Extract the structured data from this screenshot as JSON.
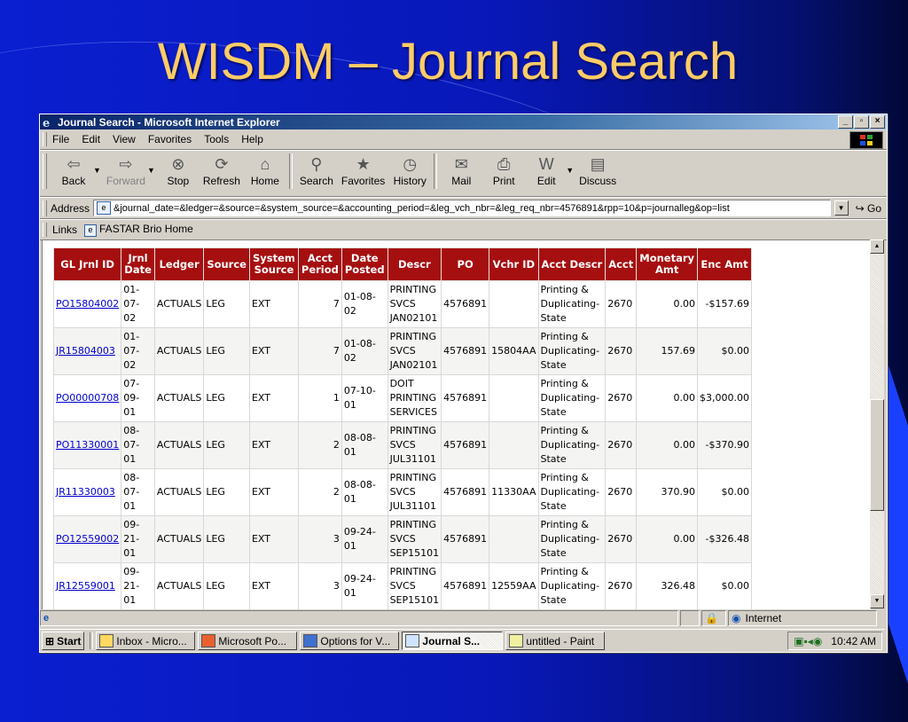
{
  "slide": {
    "title": "WISDM – Journal Search"
  },
  "window": {
    "title": "Journal Search - Microsoft Internet Explorer",
    "min": "_",
    "max": "▫",
    "close": "×"
  },
  "menu": [
    "File",
    "Edit",
    "View",
    "Favorites",
    "Tools",
    "Help"
  ],
  "toolbar": {
    "back": "Back",
    "forward": "Forward",
    "stop": "Stop",
    "refresh": "Refresh",
    "home": "Home",
    "search": "Search",
    "favorites": "Favorites",
    "history": "History",
    "mail": "Mail",
    "print": "Print",
    "edit": "Edit",
    "discuss": "Discuss"
  },
  "address": {
    "label": "Address",
    "value": "&journal_date=&ledger=&source=&system_source=&accounting_period=&leg_vch_nbr=&leg_req_nbr=4576891&rpp=10&p=journalleg&op=list",
    "go": "Go"
  },
  "links": {
    "label": "Links",
    "item": "FASTAR Brio Home"
  },
  "table": {
    "headers": [
      [
        "GL Jrnl ID"
      ],
      [
        "Jrnl",
        "Date"
      ],
      [
        "Ledger"
      ],
      [
        "Source"
      ],
      [
        "System",
        "Source"
      ],
      [
        "Acct",
        "Period"
      ],
      [
        "Date",
        "Posted"
      ],
      [
        "Descr"
      ],
      [
        "PO"
      ],
      [
        "Vchr ID"
      ],
      [
        "Acct Descr"
      ],
      [
        "Acct"
      ],
      [
        "Monetary",
        "Amt"
      ],
      [
        "Enc Amt"
      ]
    ],
    "rows": [
      {
        "id": "PO15804002",
        "jdate": [
          "01-",
          "07-",
          "02"
        ],
        "ledger": "ACTUALS",
        "source": "LEG",
        "sys": "EXT",
        "period": "7",
        "posted": [
          "01-08-",
          "02"
        ],
        "descr": [
          "PRINTING",
          "SVCS",
          "JAN02101"
        ],
        "po": "4576891",
        "vchr": "",
        "adescr": [
          "Printing &",
          "Duplicating-",
          "State"
        ],
        "acct": "2670",
        "mon": "0.00",
        "enc": "-$157.69"
      },
      {
        "id": "JR15804003",
        "jdate": [
          "01-",
          "07-",
          "02"
        ],
        "ledger": "ACTUALS",
        "source": "LEG",
        "sys": "EXT",
        "period": "7",
        "posted": [
          "01-08-",
          "02"
        ],
        "descr": [
          "PRINTING",
          "SVCS",
          "JAN02101"
        ],
        "po": "4576891",
        "vchr": "15804AA",
        "adescr": [
          "Printing &",
          "Duplicating-",
          "State"
        ],
        "acct": "2670",
        "mon": "157.69",
        "enc": "$0.00"
      },
      {
        "id": "PO00000708",
        "jdate": [
          "07-",
          "09-",
          "01"
        ],
        "ledger": "ACTUALS",
        "source": "LEG",
        "sys": "EXT",
        "period": "1",
        "posted": [
          "07-10-",
          "01"
        ],
        "descr": [
          "DOIT",
          "PRINTING",
          "SERVICES"
        ],
        "po": "4576891",
        "vchr": "",
        "adescr": [
          "Printing &",
          "Duplicating-",
          "State"
        ],
        "acct": "2670",
        "mon": "0.00",
        "enc": "$3,000.00"
      },
      {
        "id": "PO11330001",
        "jdate": [
          "08-",
          "07-",
          "01"
        ],
        "ledger": "ACTUALS",
        "source": "LEG",
        "sys": "EXT",
        "period": "2",
        "posted": [
          "08-08-",
          "01"
        ],
        "descr": [
          "PRINTING",
          "SVCS",
          "JUL31101"
        ],
        "po": "4576891",
        "vchr": "",
        "adescr": [
          "Printing &",
          "Duplicating-",
          "State"
        ],
        "acct": "2670",
        "mon": "0.00",
        "enc": "-$370.90"
      },
      {
        "id": "JR11330003",
        "jdate": [
          "08-",
          "07-",
          "01"
        ],
        "ledger": "ACTUALS",
        "source": "LEG",
        "sys": "EXT",
        "period": "2",
        "posted": [
          "08-08-",
          "01"
        ],
        "descr": [
          "PRINTING",
          "SVCS",
          "JUL31101"
        ],
        "po": "4576891",
        "vchr": "11330AA",
        "adescr": [
          "Printing &",
          "Duplicating-",
          "State"
        ],
        "acct": "2670",
        "mon": "370.90",
        "enc": "$0.00"
      },
      {
        "id": "PO12559002",
        "jdate": [
          "09-",
          "21-",
          "01"
        ],
        "ledger": "ACTUALS",
        "source": "LEG",
        "sys": "EXT",
        "period": "3",
        "posted": [
          "09-24-",
          "01"
        ],
        "descr": [
          "PRINTING",
          "SVCS",
          "SEP15101"
        ],
        "po": "4576891",
        "vchr": "",
        "adescr": [
          "Printing &",
          "Duplicating-",
          "State"
        ],
        "acct": "2670",
        "mon": "0.00",
        "enc": "-$326.48"
      },
      {
        "id": "JR12559001",
        "jdate": [
          "09-",
          "21-",
          "01"
        ],
        "ledger": "ACTUALS",
        "source": "LEG",
        "sys": "EXT",
        "period": "3",
        "posted": [
          "09-24-",
          "01"
        ],
        "descr": [
          "PRINTING",
          "SVCS",
          "SEP15101"
        ],
        "po": "4576891",
        "vchr": "12559AA",
        "adescr": [
          "Printing &",
          "Duplicating-",
          "State"
        ],
        "acct": "2670",
        "mon": "326.48",
        "enc": "$0.00"
      }
    ]
  },
  "status": {
    "zone": "Internet"
  },
  "taskbar": {
    "start": "Start",
    "tasks": [
      "Inbox - Micro...",
      "Microsoft Po...",
      "Options for V...",
      "Journal S...",
      "untitled - Paint"
    ],
    "time": "10:42 AM"
  },
  "colors": {
    "header_red": "#a60f10",
    "title_gold": "#ffcc66",
    "slide_blue": "#0a1fd0",
    "link_blue": "#0000cc"
  }
}
